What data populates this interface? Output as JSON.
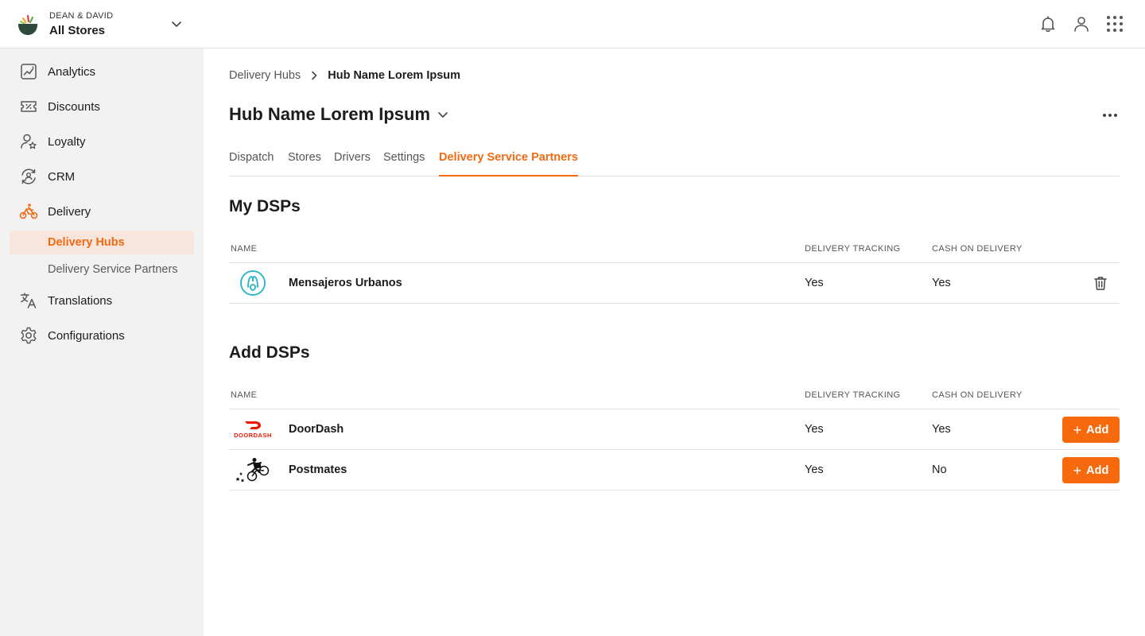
{
  "header": {
    "org_name": "DEAN & DAVID",
    "store_selector": "All Stores"
  },
  "sidebar": {
    "items": [
      {
        "label": "Analytics",
        "icon": "analytics-icon"
      },
      {
        "label": "Discounts",
        "icon": "discount-icon"
      },
      {
        "label": "Loyalty",
        "icon": "loyalty-icon"
      },
      {
        "label": "CRM",
        "icon": "crm-icon"
      },
      {
        "label": "Delivery",
        "icon": "delivery-bike-icon"
      },
      {
        "label": "Translations",
        "icon": "translate-icon"
      },
      {
        "label": "Configurations",
        "icon": "gear-icon"
      }
    ],
    "sub_items": [
      {
        "label": "Delivery Hubs"
      },
      {
        "label": "Delivery Service Partners"
      }
    ]
  },
  "breadcrumb": {
    "parent": "Delivery Hubs",
    "current": "Hub Name Lorem Ipsum"
  },
  "page": {
    "title": "Hub Name Lorem Ipsum"
  },
  "tabs": [
    {
      "label": "Dispatch"
    },
    {
      "label": "Stores"
    },
    {
      "label": "Drivers"
    },
    {
      "label": "Settings"
    },
    {
      "label": "Delivery Service Partners"
    }
  ],
  "my_dsps": {
    "title": "My DSPs",
    "columns": [
      "NAME",
      "DELIVERY TRACKING",
      "CASH ON DELIVERY"
    ],
    "rows": [
      {
        "name": "Mensajeros Urbanos",
        "tracking": "Yes",
        "cod": "Yes"
      }
    ]
  },
  "add_dsps": {
    "title": "Add DSPs",
    "columns": [
      "NAME",
      "DELIVERY TRACKING",
      "CASH ON DELIVERY"
    ],
    "add_label": "Add",
    "rows": [
      {
        "name": "DoorDash",
        "logo_text": "DOORDASH",
        "tracking": "Yes",
        "cod": "Yes"
      },
      {
        "name": "Postmates",
        "tracking": "Yes",
        "cod": "No"
      }
    ]
  },
  "colors": {
    "accent": "#f16a12",
    "button": "#f66a0d",
    "sidebar_bg": "#f2f2f2",
    "active_sub_bg": "#f8e6dc",
    "doordash_red": "#eb1700",
    "mensajeros_teal": "#1fb3c9"
  }
}
